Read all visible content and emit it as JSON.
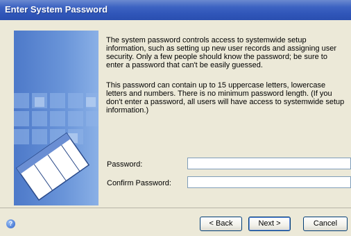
{
  "window": {
    "title": "Enter System Password"
  },
  "description": {
    "paragraph1": "The system password controls access to systemwide setup information, such as setting up new user records and assigning user security. Only a few people should know the password; be sure to enter a password that can't be easily guessed.",
    "paragraph2": "This password can contain up to 15 uppercase letters, lowercase letters and numbers. There is no minimum password length. (If you don't enter a password, all users will have access to systemwide setup information.)"
  },
  "form": {
    "password_label": "Password:",
    "password_value": "",
    "confirm_label": "Confirm Password:",
    "confirm_value": ""
  },
  "buttons": {
    "back_label": "< Back",
    "next_label": "Next >",
    "cancel_label": "Cancel"
  },
  "icons": {
    "help": "help-icon"
  },
  "colors": {
    "titlebar": "#2f55b8",
    "panel": "#ece9d8",
    "art_blue": "#4d79c9"
  }
}
